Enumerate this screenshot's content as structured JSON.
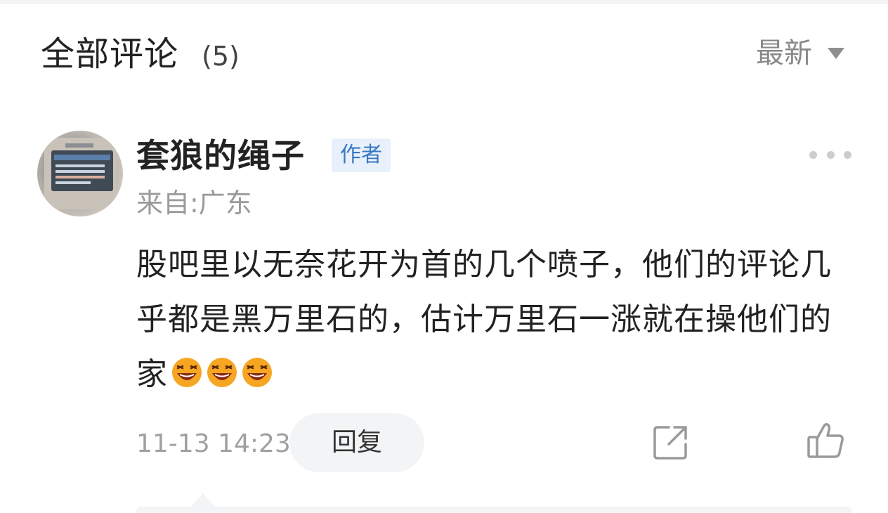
{
  "header": {
    "title": "全部评论",
    "count": "(5)",
    "sort_label": "最新"
  },
  "comment": {
    "username": "套狼的绳子",
    "badge": "作者",
    "location": "来自:广东",
    "text": "股吧里以无奈花开为首的几个喷子，他们的评论几乎都是黑万里石的，估计万里石一涨就在操他们的家",
    "emojis": [
      "laughing-emoji",
      "laughing-emoji",
      "laughing-emoji"
    ],
    "timestamp": "11-13 14:23",
    "reply_label": "回复"
  },
  "colors": {
    "badge_bg": "#e8f1fb",
    "badge_text": "#3a78c4",
    "muted_text": "#9a9a9a",
    "primary_text": "#222222"
  }
}
